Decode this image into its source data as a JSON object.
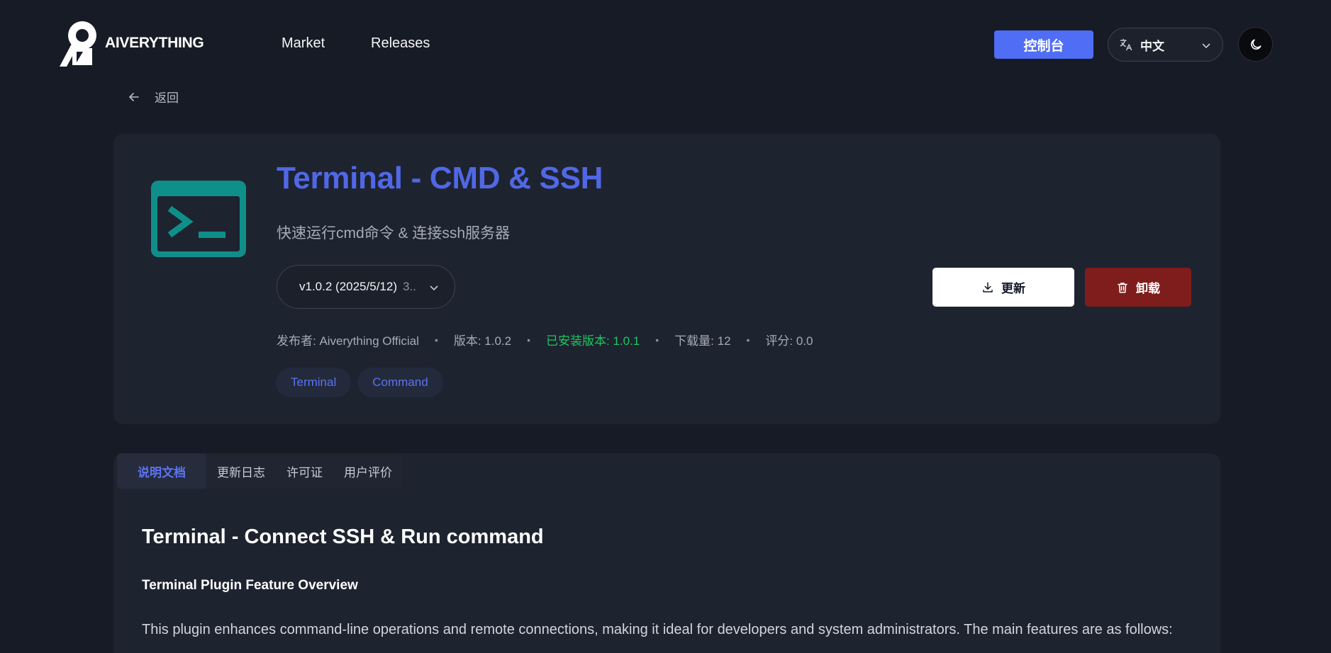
{
  "header": {
    "brand": "AIVERYTHING",
    "nav": [
      "Market",
      "Releases"
    ],
    "console_label": "控制台",
    "language": "中文"
  },
  "back_label": "返回",
  "plugin": {
    "title": "Terminal - CMD & SSH",
    "description": "快速运行cmd命令 & 连接ssh服务器",
    "version_selected": "v1.0.2 (2025/5/12)",
    "version_extra": "3..",
    "update_label": "更新",
    "uninstall_label": "卸载",
    "meta": {
      "publisher": "发布者: Aiverything Official",
      "version": "版本: 1.0.2",
      "installed": "已安装版本: 1.0.1",
      "downloads": "下载量: 12",
      "rating": "评分: 0.0",
      "separator": "•"
    },
    "tags": [
      "Terminal",
      "Command"
    ],
    "icon_color": "#0f8f8a"
  },
  "docs": {
    "tabs": [
      "说明文档",
      "更新日志",
      "许可证",
      "用户评价"
    ],
    "heading": "Terminal - Connect SSH & Run command",
    "subheading": "Terminal Plugin Feature Overview",
    "paragraph": "This plugin enhances command-line operations and remote connections, making it ideal for developers and system administrators. The main features are as follows:"
  },
  "colors": {
    "background": "#171b25",
    "card": "#1e2330",
    "accent": "#4f6df5",
    "danger": "#7f1d1d",
    "success": "#22c55e"
  }
}
